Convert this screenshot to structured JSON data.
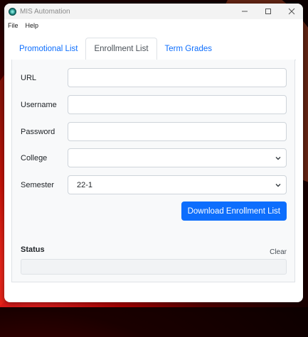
{
  "window": {
    "title": "MIS Automation"
  },
  "menu": {
    "file": "File",
    "help": "Help"
  },
  "tabs": [
    {
      "label": "Promotional List",
      "active": false
    },
    {
      "label": "Enrollment List",
      "active": true
    },
    {
      "label": "Term Grades",
      "active": false
    }
  ],
  "form": {
    "url": {
      "label": "URL",
      "value": ""
    },
    "username": {
      "label": "Username",
      "value": ""
    },
    "password": {
      "label": "Password",
      "value": ""
    },
    "college": {
      "label": "College",
      "value": ""
    },
    "semester": {
      "label": "Semester",
      "value": "22-1"
    }
  },
  "actions": {
    "download": "Download Enrollment List",
    "clear": "Clear"
  },
  "status": {
    "label": "Status",
    "text": ""
  },
  "colors": {
    "accent": "#0d6efd",
    "panel_bg": "#f8f9fa"
  }
}
